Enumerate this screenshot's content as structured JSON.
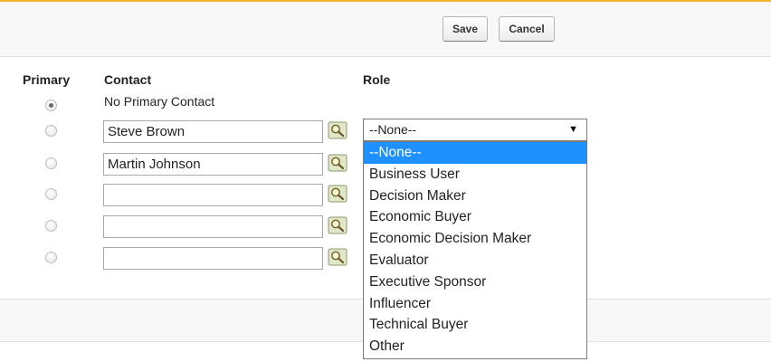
{
  "toolbar": {
    "save_label": "Save",
    "cancel_label": "Cancel"
  },
  "columns": {
    "primary": "Primary",
    "contact": "Contact",
    "role": "Role"
  },
  "no_primary_contact": "No Primary Contact",
  "rows": [
    {
      "contact": "Steve Brown"
    },
    {
      "contact": "Martin Johnson"
    },
    {
      "contact": ""
    },
    {
      "contact": ""
    },
    {
      "contact": ""
    }
  ],
  "role_select": {
    "value": "--None--"
  },
  "role_options": [
    "--None--",
    "Business User",
    "Decision Maker",
    "Economic Buyer",
    "Economic Decision Maker",
    "Evaluator",
    "Executive Sponsor",
    "Influencer",
    "Technical Buyer",
    "Other"
  ],
  "colors": {
    "accent": "#f2b62b",
    "selected_option": "#1e90ff"
  },
  "icons": [
    "lookup-icon",
    "chevron-down-icon"
  ]
}
